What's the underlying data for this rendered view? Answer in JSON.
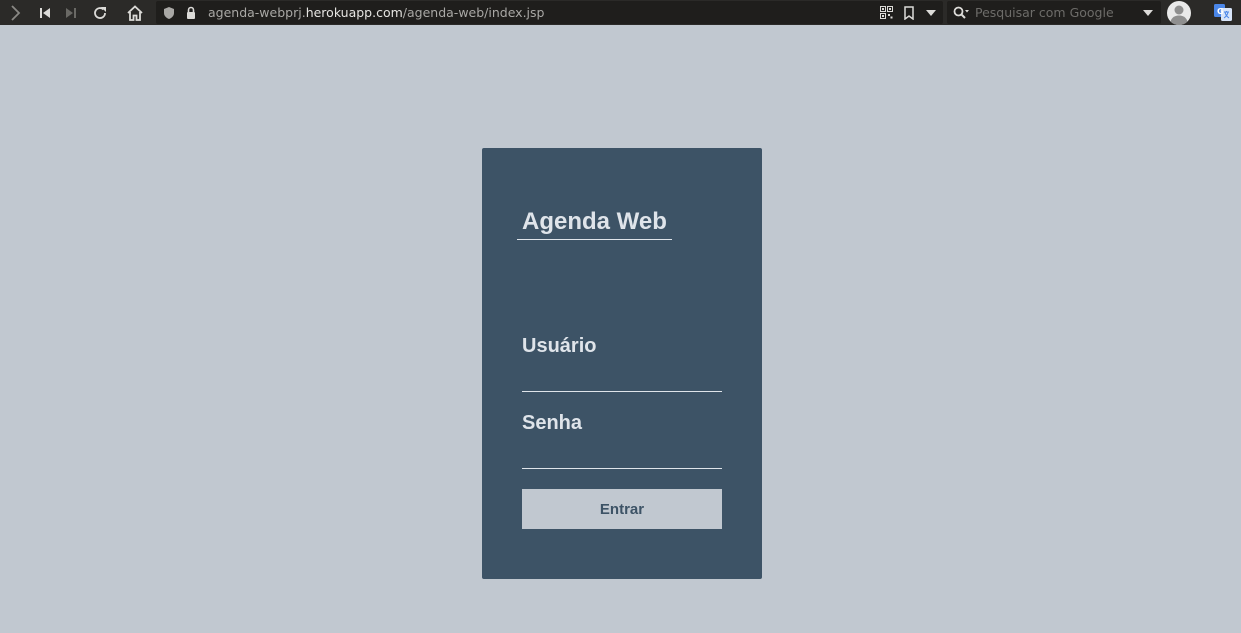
{
  "browser": {
    "url_prefix": "agenda-webprj.",
    "url_domain": "herokuapp.com",
    "url_path": "/agenda-web/index.jsp",
    "search_placeholder": "Pesquisar com Google"
  },
  "login": {
    "title": "Agenda Web",
    "username_label": "Usuário",
    "username_value": "",
    "password_label": "Senha",
    "password_value": "",
    "submit_label": "Entrar"
  },
  "colors": {
    "page_background": "#c1c8d0",
    "card_background": "#3d5366",
    "card_text": "#dfe4ea",
    "button_background": "#c1c8d0",
    "button_text": "#3d5366"
  }
}
